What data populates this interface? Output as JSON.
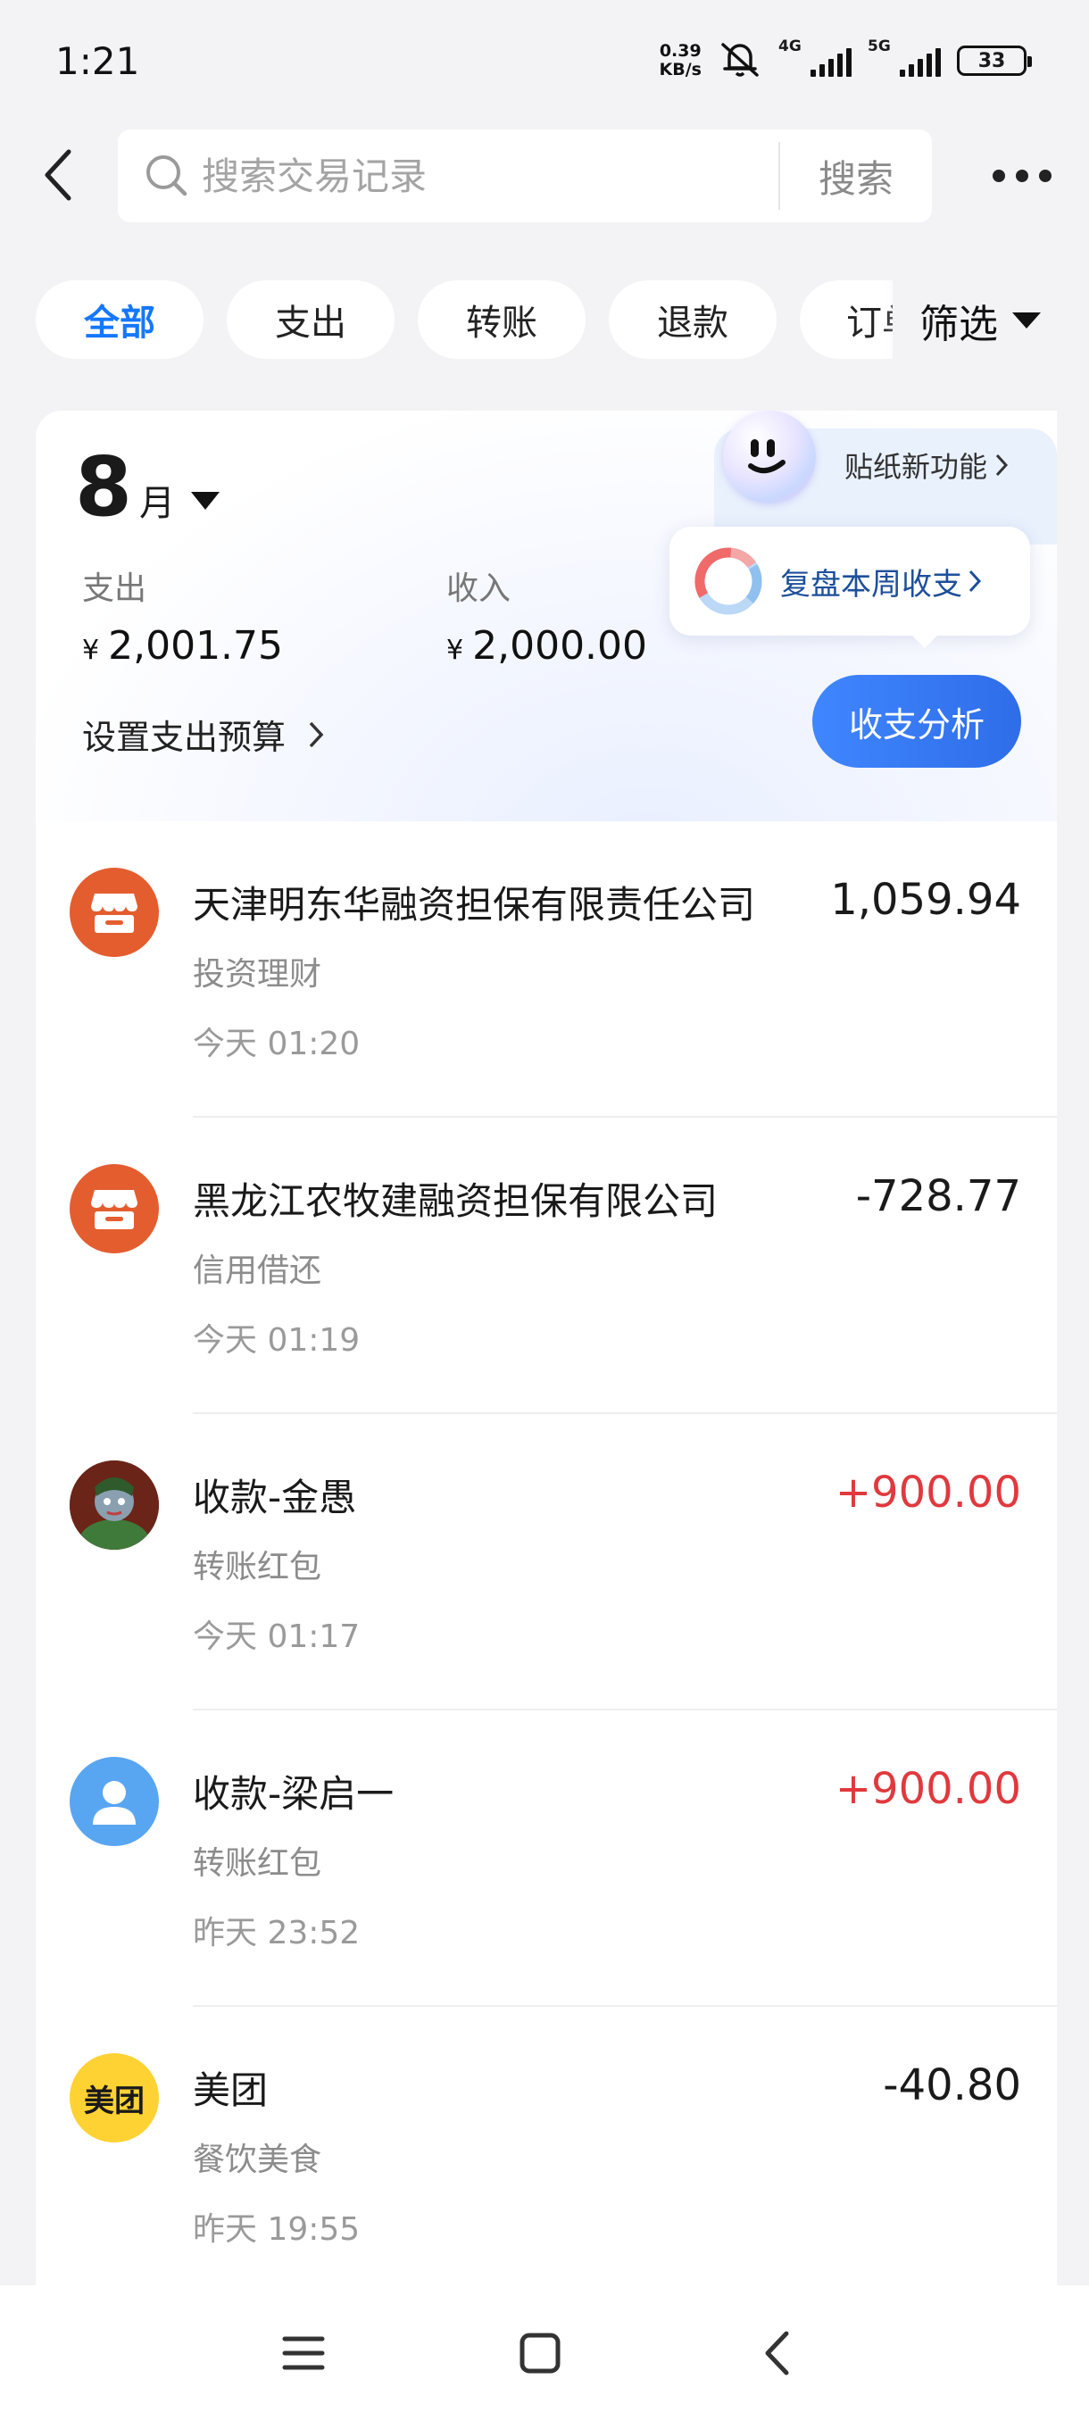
{
  "status_bar": {
    "time": "1:21",
    "net_speed_value": "0.39",
    "net_speed_unit": "KB/s",
    "sim1_label": "4G",
    "sim2_label": "5G",
    "battery": "33"
  },
  "search": {
    "placeholder": "搜索交易记录",
    "button_label": "搜索"
  },
  "filters": {
    "chips": [
      "全部",
      "支出",
      "转账",
      "退款",
      "订单"
    ],
    "active_index": 0,
    "dropdown_label": "筛选"
  },
  "summary": {
    "month_number": "8",
    "month_unit": "月",
    "expense_label": "支出",
    "expense_currency": "¥",
    "expense_value": "2,001.75",
    "income_label": "收入",
    "income_currency": "¥",
    "income_value": "2,000.00",
    "budget_link": "设置支出预算",
    "sticker_label": "贴纸新功能",
    "review_label": "复盘本周收支",
    "analysis_button": "收支分析"
  },
  "transactions": [
    {
      "name": "天津明东华融资担保有限责任公司",
      "category": "投资理财",
      "time": "今天 01:20",
      "amount": "1,059.94",
      "avatar": "shop-icon"
    },
    {
      "name": "黑龙江农牧建融资担保有限公司",
      "category": "信用借还",
      "time": "今天 01:19",
      "amount": "-728.77",
      "avatar": "shop-icon"
    },
    {
      "name": "收款-金愚",
      "category": "转账红包",
      "time": "今天 01:17",
      "amount": "+900.00",
      "avatar": "photo-avatar"
    },
    {
      "name": "收款-梁启一",
      "category": "转账红包",
      "time": "昨天 23:52",
      "amount": "+900.00",
      "avatar": "person-icon"
    },
    {
      "name": "美团",
      "category": "餐饮美食",
      "time": "昨天 19:55",
      "amount": "-40.80",
      "avatar": "meituan-logo",
      "avatar_text": "美团"
    }
  ],
  "colors": {
    "accent": "#1677ff",
    "income": "#e0393e",
    "shop_avatar": "#e45d2f",
    "person_avatar": "#58a6f2",
    "meituan_avatar": "#ffd234"
  }
}
